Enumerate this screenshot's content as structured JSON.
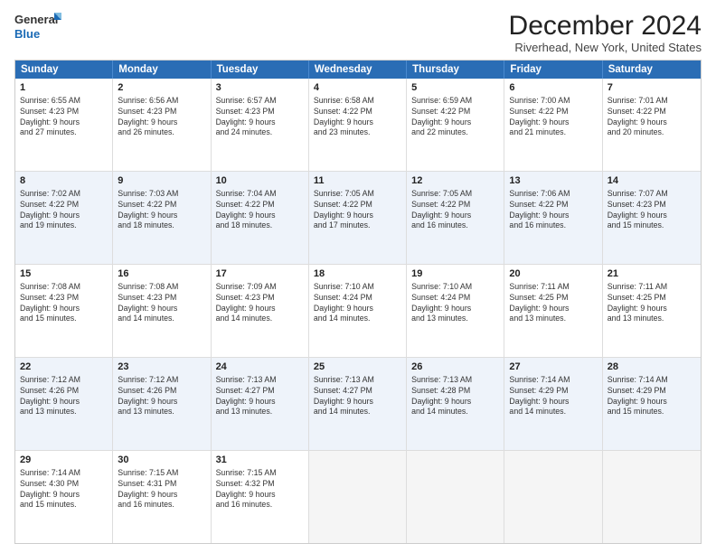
{
  "logo": {
    "line1": "General",
    "line2": "Blue"
  },
  "title": "December 2024",
  "subtitle": "Riverhead, New York, United States",
  "weekdays": [
    "Sunday",
    "Monday",
    "Tuesday",
    "Wednesday",
    "Thursday",
    "Friday",
    "Saturday"
  ],
  "weeks": [
    [
      {
        "day": "1",
        "sunrise": "Sunrise: 6:55 AM",
        "sunset": "Sunset: 4:23 PM",
        "daylight": "Daylight: 9 hours and 27 minutes."
      },
      {
        "day": "2",
        "sunrise": "Sunrise: 6:56 AM",
        "sunset": "Sunset: 4:23 PM",
        "daylight": "Daylight: 9 hours and 26 minutes."
      },
      {
        "day": "3",
        "sunrise": "Sunrise: 6:57 AM",
        "sunset": "Sunset: 4:23 PM",
        "daylight": "Daylight: 9 hours and 24 minutes."
      },
      {
        "day": "4",
        "sunrise": "Sunrise: 6:58 AM",
        "sunset": "Sunset: 4:22 PM",
        "daylight": "Daylight: 9 hours and 23 minutes."
      },
      {
        "day": "5",
        "sunrise": "Sunrise: 6:59 AM",
        "sunset": "Sunset: 4:22 PM",
        "daylight": "Daylight: 9 hours and 22 minutes."
      },
      {
        "day": "6",
        "sunrise": "Sunrise: 7:00 AM",
        "sunset": "Sunset: 4:22 PM",
        "daylight": "Daylight: 9 hours and 21 minutes."
      },
      {
        "day": "7",
        "sunrise": "Sunrise: 7:01 AM",
        "sunset": "Sunset: 4:22 PM",
        "daylight": "Daylight: 9 hours and 20 minutes."
      }
    ],
    [
      {
        "day": "8",
        "sunrise": "Sunrise: 7:02 AM",
        "sunset": "Sunset: 4:22 PM",
        "daylight": "Daylight: 9 hours and 19 minutes."
      },
      {
        "day": "9",
        "sunrise": "Sunrise: 7:03 AM",
        "sunset": "Sunset: 4:22 PM",
        "daylight": "Daylight: 9 hours and 18 minutes."
      },
      {
        "day": "10",
        "sunrise": "Sunrise: 7:04 AM",
        "sunset": "Sunset: 4:22 PM",
        "daylight": "Daylight: 9 hours and 18 minutes."
      },
      {
        "day": "11",
        "sunrise": "Sunrise: 7:05 AM",
        "sunset": "Sunset: 4:22 PM",
        "daylight": "Daylight: 9 hours and 17 minutes."
      },
      {
        "day": "12",
        "sunrise": "Sunrise: 7:05 AM",
        "sunset": "Sunset: 4:22 PM",
        "daylight": "Daylight: 9 hours and 16 minutes."
      },
      {
        "day": "13",
        "sunrise": "Sunrise: 7:06 AM",
        "sunset": "Sunset: 4:22 PM",
        "daylight": "Daylight: 9 hours and 16 minutes."
      },
      {
        "day": "14",
        "sunrise": "Sunrise: 7:07 AM",
        "sunset": "Sunset: 4:23 PM",
        "daylight": "Daylight: 9 hours and 15 minutes."
      }
    ],
    [
      {
        "day": "15",
        "sunrise": "Sunrise: 7:08 AM",
        "sunset": "Sunset: 4:23 PM",
        "daylight": "Daylight: 9 hours and 15 minutes."
      },
      {
        "day": "16",
        "sunrise": "Sunrise: 7:08 AM",
        "sunset": "Sunset: 4:23 PM",
        "daylight": "Daylight: 9 hours and 14 minutes."
      },
      {
        "day": "17",
        "sunrise": "Sunrise: 7:09 AM",
        "sunset": "Sunset: 4:23 PM",
        "daylight": "Daylight: 9 hours and 14 minutes."
      },
      {
        "day": "18",
        "sunrise": "Sunrise: 7:10 AM",
        "sunset": "Sunset: 4:24 PM",
        "daylight": "Daylight: 9 hours and 14 minutes."
      },
      {
        "day": "19",
        "sunrise": "Sunrise: 7:10 AM",
        "sunset": "Sunset: 4:24 PM",
        "daylight": "Daylight: 9 hours and 13 minutes."
      },
      {
        "day": "20",
        "sunrise": "Sunrise: 7:11 AM",
        "sunset": "Sunset: 4:25 PM",
        "daylight": "Daylight: 9 hours and 13 minutes."
      },
      {
        "day": "21",
        "sunrise": "Sunrise: 7:11 AM",
        "sunset": "Sunset: 4:25 PM",
        "daylight": "Daylight: 9 hours and 13 minutes."
      }
    ],
    [
      {
        "day": "22",
        "sunrise": "Sunrise: 7:12 AM",
        "sunset": "Sunset: 4:26 PM",
        "daylight": "Daylight: 9 hours and 13 minutes."
      },
      {
        "day": "23",
        "sunrise": "Sunrise: 7:12 AM",
        "sunset": "Sunset: 4:26 PM",
        "daylight": "Daylight: 9 hours and 13 minutes."
      },
      {
        "day": "24",
        "sunrise": "Sunrise: 7:13 AM",
        "sunset": "Sunset: 4:27 PM",
        "daylight": "Daylight: 9 hours and 13 minutes."
      },
      {
        "day": "25",
        "sunrise": "Sunrise: 7:13 AM",
        "sunset": "Sunset: 4:27 PM",
        "daylight": "Daylight: 9 hours and 14 minutes."
      },
      {
        "day": "26",
        "sunrise": "Sunrise: 7:13 AM",
        "sunset": "Sunset: 4:28 PM",
        "daylight": "Daylight: 9 hours and 14 minutes."
      },
      {
        "day": "27",
        "sunrise": "Sunrise: 7:14 AM",
        "sunset": "Sunset: 4:29 PM",
        "daylight": "Daylight: 9 hours and 14 minutes."
      },
      {
        "day": "28",
        "sunrise": "Sunrise: 7:14 AM",
        "sunset": "Sunset: 4:29 PM",
        "daylight": "Daylight: 9 hours and 15 minutes."
      }
    ],
    [
      {
        "day": "29",
        "sunrise": "Sunrise: 7:14 AM",
        "sunset": "Sunset: 4:30 PM",
        "daylight": "Daylight: 9 hours and 15 minutes."
      },
      {
        "day": "30",
        "sunrise": "Sunrise: 7:15 AM",
        "sunset": "Sunset: 4:31 PM",
        "daylight": "Daylight: 9 hours and 16 minutes."
      },
      {
        "day": "31",
        "sunrise": "Sunrise: 7:15 AM",
        "sunset": "Sunset: 4:32 PM",
        "daylight": "Daylight: 9 hours and 16 minutes."
      },
      null,
      null,
      null,
      null
    ]
  ]
}
